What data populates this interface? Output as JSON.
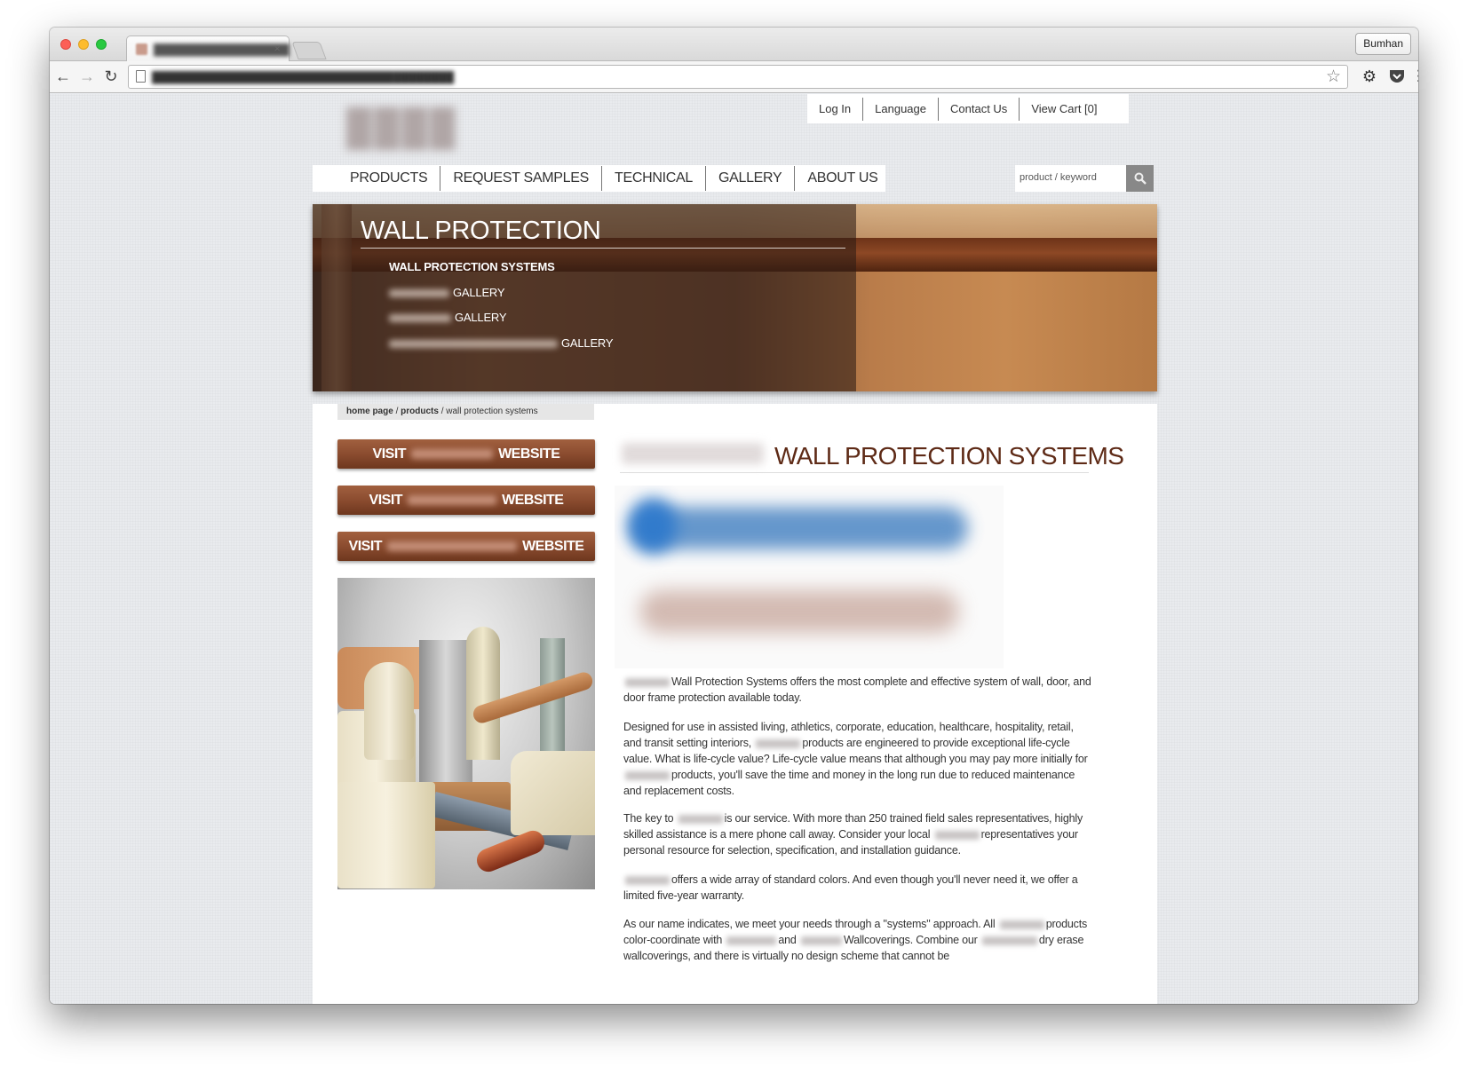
{
  "browser": {
    "profile_name": "Bumhan",
    "tab_close": "×",
    "icons": [
      "back-icon",
      "forward-icon",
      "reload-icon",
      "page-icon",
      "star-icon",
      "gear-icon",
      "pocket-icon",
      "menu-icon"
    ]
  },
  "site": {
    "utility_nav": [
      "Log In",
      "Language",
      "Contact Us",
      "View Cart [0]"
    ],
    "main_nav": [
      "PRODUCTS",
      "REQUEST SAMPLES",
      "TECHNICAL",
      "GALLERY",
      "ABOUT US"
    ],
    "search": {
      "placeholder": "product / keyword"
    },
    "hero": {
      "title": "WALL PROTECTION",
      "links": [
        "WALL PROTECTION SYSTEMS",
        "GALLERY",
        "GALLERY",
        "GALLERY"
      ]
    },
    "breadcrumb": {
      "home": "home page",
      "sep": "/",
      "products": "products",
      "current": "wall protection systems"
    },
    "visit_buttons": [
      {
        "prefix": "VISIT",
        "suffix": "WEBSITE"
      },
      {
        "prefix": "VISIT",
        "suffix": "WEBSITE"
      },
      {
        "prefix": "VISIT",
        "suffix": "WEBSITE"
      }
    ],
    "page_title": "WALL PROTECTION SYSTEMS",
    "paragraphs": {
      "p1_a": "Wall Protection Systems offers the most complete and effective system of wall, door, and door frame protection available today.",
      "p2_a": "Designed for use in assisted living, athletics, corporate, education, healthcare, hospitality, retail, and transit setting interiors,",
      "p2_b": "products are engineered to provide exceptional life-cycle value. What is life-cycle value? Life-cycle value means that although you may pay more initially for",
      "p2_c": "products, you'll save the time and money in the long run due to reduced maintenance and replacement costs.",
      "p3_a": "The key to",
      "p3_b": "is our service. With more than 250 trained field sales representatives, highly skilled assistance is a mere phone call away. Consider your local",
      "p3_c": "representatives your personal resource for selection, specification, and installation guidance.",
      "p4_a": "offers a wide array of standard colors. And even though you'll never need it, we offer a limited five-year warranty.",
      "p5_a": "As our name indicates, we meet your needs through a \"systems\" approach. All",
      "p5_b": "products color-coordinate with",
      "p5_c": "and",
      "p5_d": "Wallcoverings. Combine our",
      "p5_e": "dry erase wallcoverings, and there is virtually no design scheme that cannot be"
    }
  }
}
